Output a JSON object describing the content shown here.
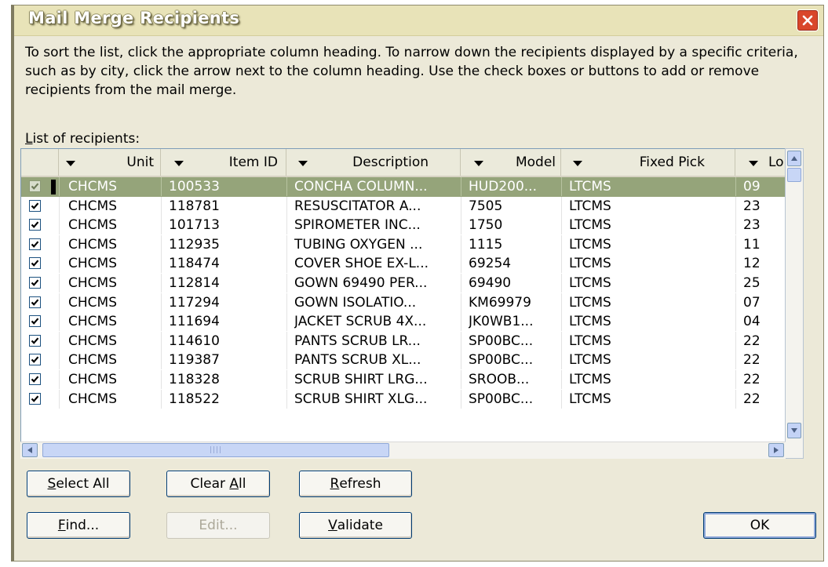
{
  "window": {
    "title": "Mail Merge Recipients"
  },
  "instructions": "To sort the list, click the appropriate column heading.  To narrow down the recipients displayed by a specific criteria, such as by city, click the arrow next to the column heading.  Use the check boxes or buttons to add or remove recipients from the mail merge.",
  "list_label": {
    "accel": "L",
    "rest": "ist of recipients:"
  },
  "columns": [
    "Unit",
    "Item ID",
    "Description",
    "Model",
    "Fixed Pick",
    "Lo"
  ],
  "rows": [
    {
      "checked": true,
      "selected": true,
      "unit": "CHCMS",
      "item_id": "100533",
      "description": "CONCHA COLUMN...",
      "model": "HUD200...",
      "fixed_pick": "LTCMS",
      "loc": "09"
    },
    {
      "checked": true,
      "selected": false,
      "unit": "CHCMS",
      "item_id": "118781",
      "description": "RESUSCITATOR A...",
      "model": "7505",
      "fixed_pick": "LTCMS",
      "loc": "23"
    },
    {
      "checked": true,
      "selected": false,
      "unit": "CHCMS",
      "item_id": "101713",
      "description": "SPIROMETER INC...",
      "model": "1750",
      "fixed_pick": "LTCMS",
      "loc": "23"
    },
    {
      "checked": true,
      "selected": false,
      "unit": "CHCMS",
      "item_id": "112935",
      "description": "TUBING OXYGEN ...",
      "model": "1115",
      "fixed_pick": "LTCMS",
      "loc": "11"
    },
    {
      "checked": true,
      "selected": false,
      "unit": "CHCMS",
      "item_id": "118474",
      "description": "COVER SHOE EX-L...",
      "model": "69254",
      "fixed_pick": "LTCMS",
      "loc": "12"
    },
    {
      "checked": true,
      "selected": false,
      "unit": "CHCMS",
      "item_id": "112814",
      "description": "GOWN 69490 PER...",
      "model": "69490",
      "fixed_pick": "LTCMS",
      "loc": "25"
    },
    {
      "checked": true,
      "selected": false,
      "unit": "CHCMS",
      "item_id": "117294",
      "description": "GOWN ISOLATIO...",
      "model": "KM69979",
      "fixed_pick": "LTCMS",
      "loc": "07"
    },
    {
      "checked": true,
      "selected": false,
      "unit": "CHCMS",
      "item_id": "111694",
      "description": "JACKET SCRUB 4X...",
      "model": "JK0WB1...",
      "fixed_pick": "LTCMS",
      "loc": "04"
    },
    {
      "checked": true,
      "selected": false,
      "unit": "CHCMS",
      "item_id": "114610",
      "description": "PANTS SCRUB LR...",
      "model": "SP00BC...",
      "fixed_pick": "LTCMS",
      "loc": "22"
    },
    {
      "checked": true,
      "selected": false,
      "unit": "CHCMS",
      "item_id": "119387",
      "description": "PANTS SCRUB XL...",
      "model": "SP00BC...",
      "fixed_pick": "LTCMS",
      "loc": "22"
    },
    {
      "checked": true,
      "selected": false,
      "unit": "CHCMS",
      "item_id": "118328",
      "description": "SCRUB SHIRT LRG...",
      "model": "SROOB...",
      "fixed_pick": "LTCMS",
      "loc": "22"
    },
    {
      "checked": true,
      "selected": false,
      "unit": "CHCMS",
      "item_id": "118522",
      "description": "SCRUB SHIRT XLG...",
      "model": "SP00BC...",
      "fixed_pick": "LTCMS",
      "loc": "22"
    }
  ],
  "buttons": {
    "select_all": {
      "accel": "S",
      "rest": "elect All"
    },
    "clear_all": {
      "pre": "Clear ",
      "accel": "A",
      "rest": "ll"
    },
    "refresh": {
      "accel": "R",
      "rest": "efresh"
    },
    "find": {
      "accel": "F",
      "rest": "ind..."
    },
    "edit": "Edit...",
    "validate": {
      "accel": "V",
      "rest": "alidate"
    },
    "ok": "OK"
  },
  "icons": {
    "close": "close-x-icon",
    "scroll_up": "triangle-up-icon",
    "scroll_down": "triangle-down-icon",
    "scroll_left": "triangle-left-icon",
    "scroll_right": "triangle-right-icon",
    "filter": "dropdown-arrow-icon",
    "check": "checkmark-icon"
  },
  "colors": {
    "title_bar": "#e8e3b8",
    "dialog_bg": "#ece9d8",
    "selected_row": "#95a47a",
    "close_button": "#d9462a"
  }
}
